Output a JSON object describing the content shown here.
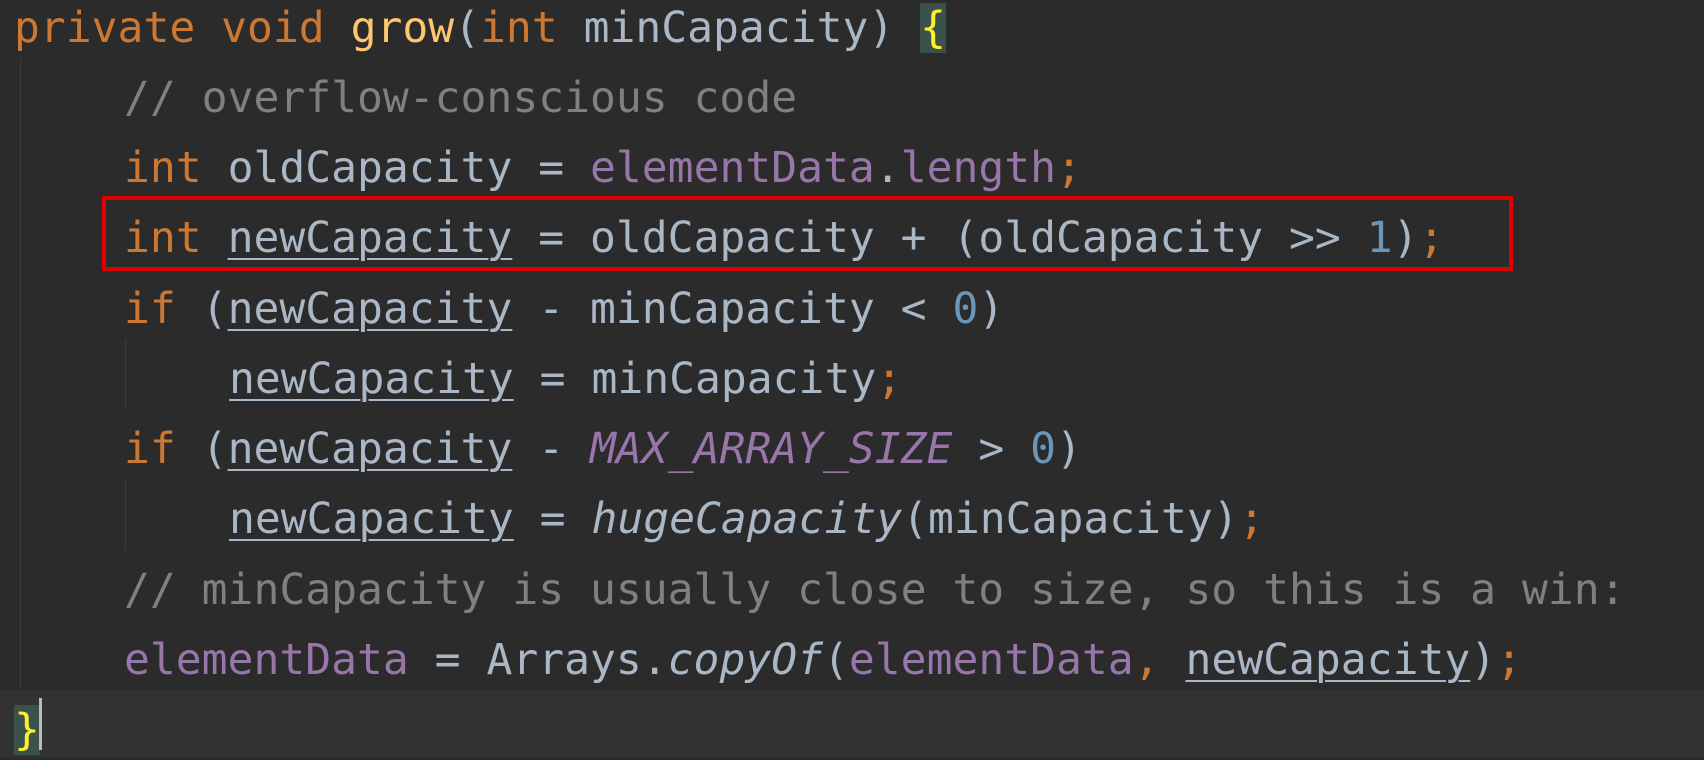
{
  "code": {
    "l0": {
      "kw_private": "private",
      "kw_void": "void",
      "fn_grow": "grow",
      "paren_open": "(",
      "kw_int": "int",
      "param": "minCapacity",
      "paren_close": ")",
      "brace": "{"
    },
    "l1": {
      "comment": "// overflow-conscious code"
    },
    "l2": {
      "kw_int": "int",
      "var": "oldCapacity",
      "eq": "=",
      "field": "elementData",
      "dot": ".",
      "length": "length",
      "semi": ";"
    },
    "l3": {
      "kw_int": "int",
      "var": "newCapacity",
      "eq": "=",
      "expr_a": "oldCapacity + (oldCapacity >> ",
      "num": "1",
      "close": ")",
      "semi": ";"
    },
    "l4": {
      "kw_if": "if",
      "open": "(",
      "var": "newCapacity",
      "rest": "- minCapacity <",
      "num": "0",
      "close": ")"
    },
    "l5": {
      "var": "newCapacity",
      "rest": "= minCapacity",
      "semi": ";"
    },
    "l6": {
      "kw_if": "if",
      "open": "(",
      "var": "newCapacity",
      "minus": "-",
      "const": "MAX_ARRAY_SIZE",
      "gt": ">",
      "num": "0",
      "close": ")"
    },
    "l7": {
      "var": "newCapacity",
      "eq": "=",
      "call": "hugeCapacity",
      "args": "(minCapacity)",
      "semi": ";"
    },
    "l8": {
      "comment": "// minCapacity is usually close to size, so this is a win:"
    },
    "l9": {
      "field": "elementData",
      "eq": "=",
      "cls": "Arrays.",
      "call": "copyOf",
      "open": "(",
      "field2": "elementData",
      "comma": ",",
      "var": "newCapacity",
      "close": ")",
      "semi": ";"
    },
    "l10": {
      "brace": "}"
    }
  },
  "colors": {
    "background": "#2b2b2b",
    "keyword": "#cc7832",
    "function": "#ffc66d",
    "field": "#9876aa",
    "number": "#6897bb",
    "comment": "#808080",
    "text": "#a9b7c6",
    "highlight_box": "#e00000"
  }
}
